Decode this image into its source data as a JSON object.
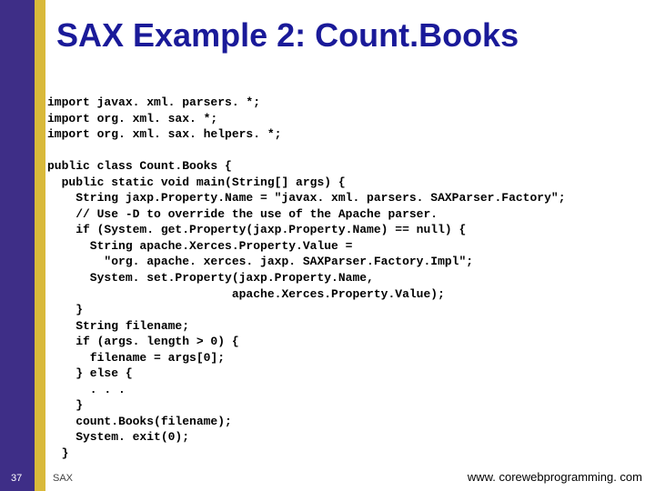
{
  "title": "SAX Example 2: Count.Books",
  "code": "import javax. xml. parsers. *;\nimport org. xml. sax. *;\nimport org. xml. sax. helpers. *;\n\npublic class Count.Books {\n  public static void main(String[] args) {\n    String jaxp.Property.Name = \"javax. xml. parsers. SAXParser.Factory\";\n    // Use -D to override the use of the Apache parser.\n    if (System. get.Property(jaxp.Property.Name) == null) {\n      String apache.Xerces.Property.Value =\n        \"org. apache. xerces. jaxp. SAXParser.Factory.Impl\";\n      System. set.Property(jaxp.Property.Name,\n                          apache.Xerces.Property.Value);\n    }\n    String filename;\n    if (args. length > 0) {\n      filename = args[0];\n    } else {\n      . . .\n    }\n    count.Books(filename);\n    System. exit(0);\n  }",
  "slide_number": "37",
  "footer_left": "SAX",
  "footer_right": "www. corewebprogramming. com"
}
